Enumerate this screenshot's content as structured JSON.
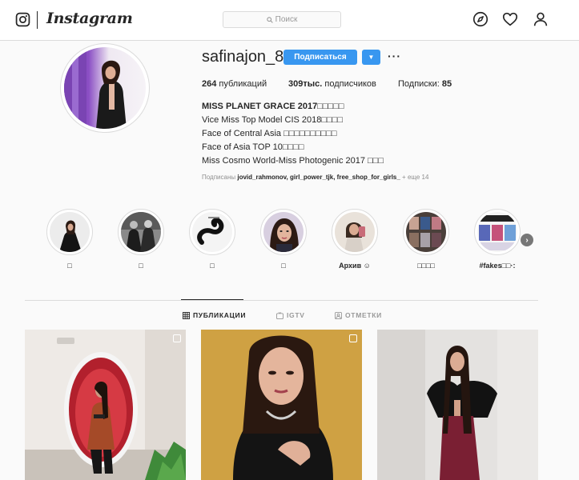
{
  "header": {
    "brand": "Instagram",
    "search_placeholder": "Поиск",
    "nav_icons": [
      "compass-icon",
      "heart-icon",
      "user-icon"
    ]
  },
  "profile": {
    "username": "safinajon_8",
    "follow_label": "Подписаться",
    "stats": {
      "posts_count": "264",
      "posts_label": "публикаций",
      "followers_count": "309тыс.",
      "followers_label": "подписчиков",
      "following_label": "Подписки:",
      "following_count": "85"
    },
    "bio": {
      "name": "MISS PLANET GRACE 2017□□□□□",
      "lines": [
        "Vice Miss Top Model CIS 2018□□□□",
        "Face of Central Asia □□□□□□□□□□",
        "Face of Asia TOP 10□□□□",
        "Miss Cosmo World-Miss Photogenic 2017 □□□"
      ]
    },
    "followed_by": {
      "prefix": "Подписаны",
      "users": "jovid_rahmonov, girl_power_tjk, free_shop_for_girls_",
      "more": "+ еще 14"
    }
  },
  "highlights": [
    {
      "label": "□"
    },
    {
      "label": "□"
    },
    {
      "label": "□"
    },
    {
      "label": "□"
    },
    {
      "label": "Архив ☺"
    },
    {
      "label": "□□□□"
    },
    {
      "label": "#fakes□□·:"
    }
  ],
  "tabs": [
    {
      "label": "ПУБЛИКАЦИИ",
      "icon": "grid-icon",
      "active": true
    },
    {
      "label": "IGTV",
      "icon": "igtv-icon",
      "active": false
    },
    {
      "label": "ОТМЕТКИ",
      "icon": "tagged-icon",
      "active": false
    }
  ],
  "colors": {
    "accent": "#3897f0",
    "border": "#dbdbdb",
    "text": "#262626",
    "muted": "#8e8e8e"
  }
}
